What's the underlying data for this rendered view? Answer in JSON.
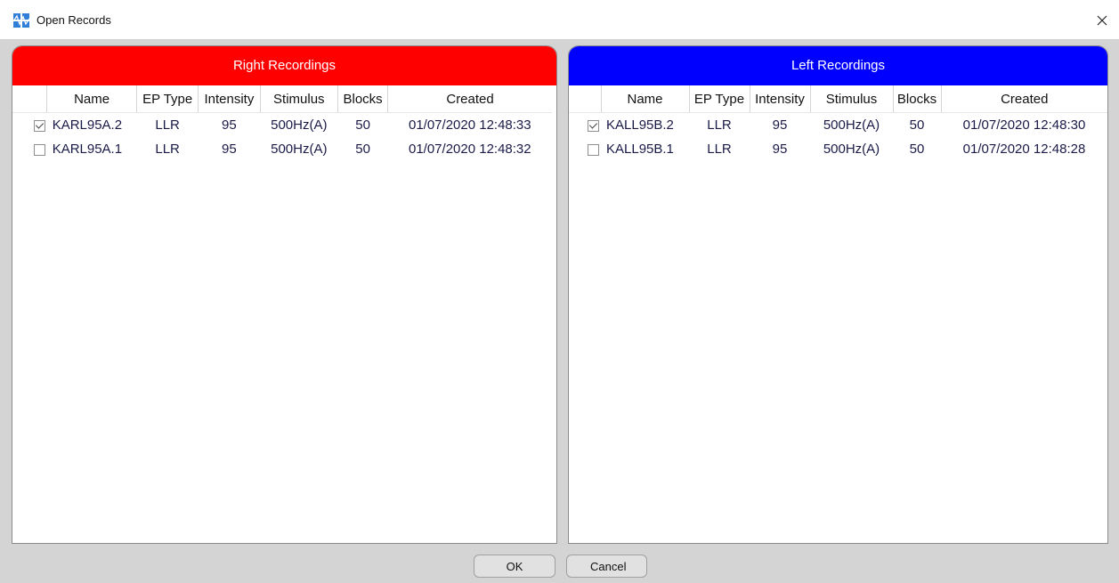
{
  "window": {
    "title": "Open Records",
    "close_symbol": "✕"
  },
  "columns": [
    "Name",
    "EP Type",
    "Intensity",
    "Stimulus",
    "Blocks",
    "Created"
  ],
  "right_panel": {
    "title": "Right Recordings",
    "header_color": "#ff0000",
    "rows": [
      {
        "checked": true,
        "name": "KARL95A.2",
        "ep_type": "LLR",
        "intensity": "95",
        "stimulus": "500Hz(A)",
        "blocks": "50",
        "created": "01/07/2020 12:48:33"
      },
      {
        "checked": false,
        "name": "KARL95A.1",
        "ep_type": "LLR",
        "intensity": "95",
        "stimulus": "500Hz(A)",
        "blocks": "50",
        "created": "01/07/2020 12:48:32"
      }
    ]
  },
  "left_panel": {
    "title": "Left Recordings",
    "header_color": "#0000ff",
    "rows": [
      {
        "checked": true,
        "name": "KALL95B.2",
        "ep_type": "LLR",
        "intensity": "95",
        "stimulus": "500Hz(A)",
        "blocks": "50",
        "created": "01/07/2020 12:48:30"
      },
      {
        "checked": false,
        "name": "KALL95B.1",
        "ep_type": "LLR",
        "intensity": "95",
        "stimulus": "500Hz(A)",
        "blocks": "50",
        "created": "01/07/2020 12:48:28"
      }
    ]
  },
  "buttons": {
    "ok": "OK",
    "cancel": "Cancel"
  }
}
